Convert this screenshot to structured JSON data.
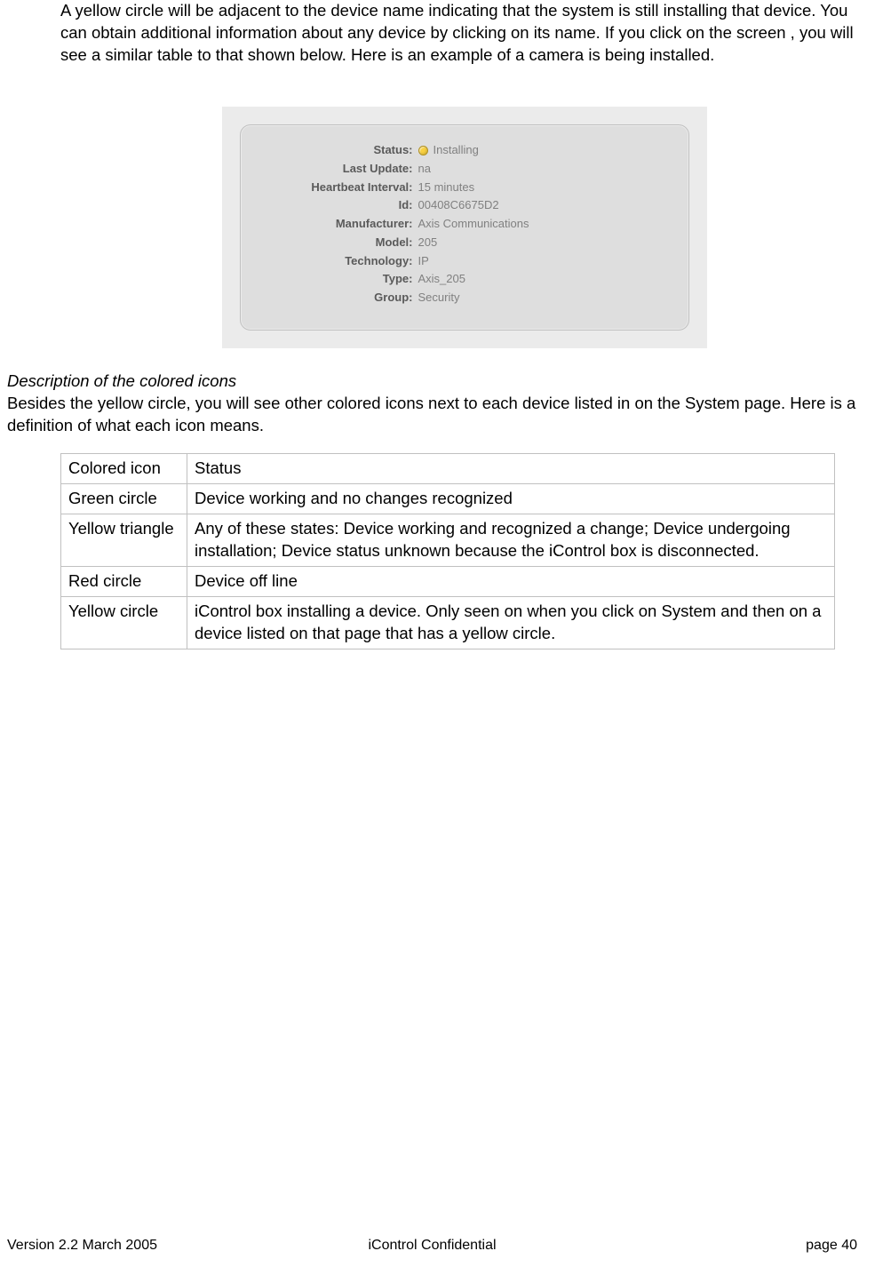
{
  "intro_text": "A yellow circle will be adjacent to the device name indicating that the system is still installing that device.  You can obtain additional information about any device by clicking on its name.  If you click on the screen , you will see a similar table to that shown below.  Here is an example of a camera is being installed.",
  "device_panel": {
    "rows": [
      {
        "label": "Status:",
        "value": "Installing",
        "has_icon": true
      },
      {
        "label": "Last Update:",
        "value": "na",
        "has_icon": false
      },
      {
        "label": "Heartbeat Interval:",
        "value": "15 minutes",
        "has_icon": false
      },
      {
        "label": "Id:",
        "value": "00408C6675D2",
        "has_icon": false
      },
      {
        "label": "Manufacturer:",
        "value": "Axis Communications",
        "has_icon": false
      },
      {
        "label": "Model:",
        "value": "205",
        "has_icon": false
      },
      {
        "label": "Technology:",
        "value": "IP",
        "has_icon": false
      },
      {
        "label": "Type:",
        "value": "Axis_205",
        "has_icon": false
      },
      {
        "label": "Group:",
        "value": "Security",
        "has_icon": false
      }
    ]
  },
  "section_title": "Description of the colored icons",
  "section_para": "Besides the yellow circle, you will see other colored icons next to each device listed in on the System page.  Here is a definition of what each icon means.",
  "icon_table": {
    "header": {
      "col1": "Colored icon",
      "col2": "Status"
    },
    "rows": [
      {
        "icon": "Green circle",
        "status": "Device working and no changes recognized"
      },
      {
        "icon": "Yellow triangle",
        "status": "Any of these states:  Device working and recognized a change; Device undergoing installation; Device status unknown because the iControl box is disconnected."
      },
      {
        "icon": "Red circle",
        "status": "Device off line"
      },
      {
        "icon": "Yellow circle",
        "status": "iControl box installing a device.  Only seen on when you click on System and then on a device listed on that page that has a yellow circle."
      }
    ]
  },
  "footer": {
    "left": "Version 2.2 March 2005",
    "center": "iControl     Confidential",
    "right": "page 40"
  }
}
